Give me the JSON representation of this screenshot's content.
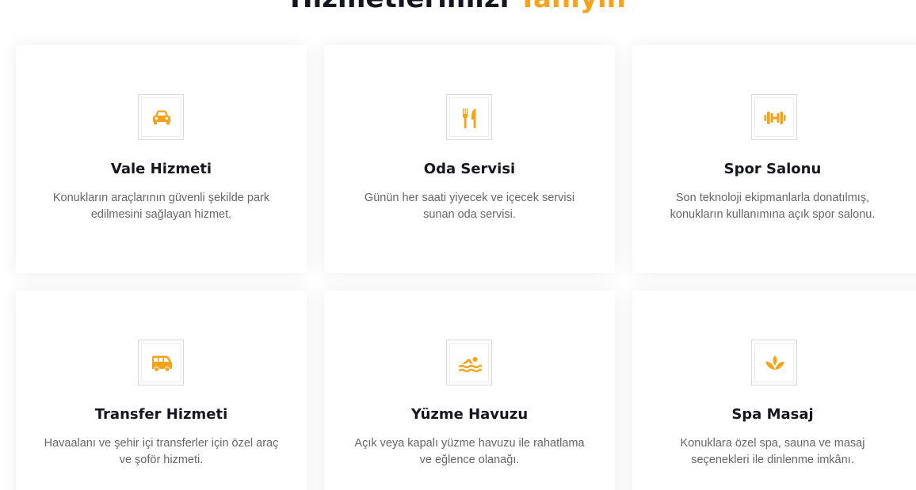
{
  "section": {
    "title_main": "Hizmetlerimizi ",
    "title_accent": "Tanıyın"
  },
  "colors": {
    "accent": "#f7a21b",
    "heading": "#16161e",
    "body_text": "#666666"
  },
  "services": [
    {
      "icon": "car-icon",
      "title": "Vale Hizmeti",
      "description": "Konukların araçlarının güvenli şekilde park edilmesini sağlayan hizmet."
    },
    {
      "icon": "utensils-icon",
      "title": "Oda Servisi",
      "description": "Günün her saati yiyecek ve içecek servisi sunan oda servisi."
    },
    {
      "icon": "dumbbell-icon",
      "title": "Spor Salonu",
      "description": "Son teknoloji ekipmanlarla donatılmış, konukların kullanımına açık spor salonu."
    },
    {
      "icon": "shuttle-van-icon",
      "title": "Transfer Hizmeti",
      "description": "Havaalanı ve şehir içi transferler için özel araç ve şoför hizmeti."
    },
    {
      "icon": "swimmer-icon",
      "title": "Yüzme Havuzu",
      "description": "Açık veya kapalı yüzme havuzu ile rahatlama ve eğlence olanağı."
    },
    {
      "icon": "spa-lotus-icon",
      "title": "Spa Masaj",
      "description": "Konuklara özel spa, sauna ve masaj seçenekleri ile dinlenme imkânı."
    }
  ]
}
